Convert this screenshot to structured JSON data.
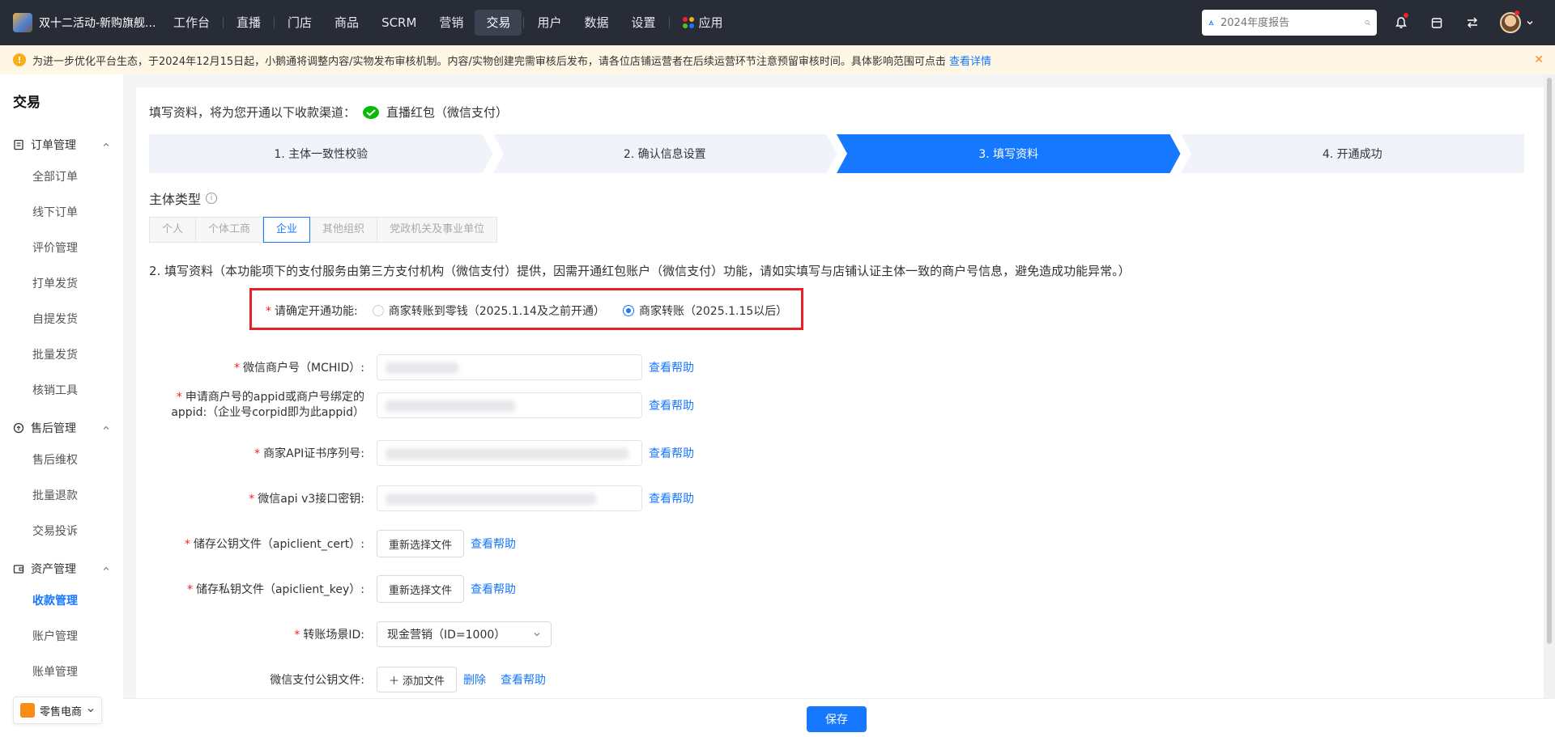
{
  "topbar": {
    "brand": "双十二活动-新购旗舰...",
    "nav": [
      {
        "label": "工作台"
      },
      {
        "label": "直播"
      },
      {
        "label": "门店"
      },
      {
        "label": "商品"
      },
      {
        "label": "SCRM"
      },
      {
        "label": "营销"
      },
      {
        "label": "交易"
      },
      {
        "label": "用户"
      },
      {
        "label": "数据"
      },
      {
        "label": "设置"
      },
      {
        "label": "应用"
      }
    ],
    "search_placeholder": "2024年度报告",
    "accent": "#272c37"
  },
  "notice": {
    "text": "为进一步优化平台生态，于2024年12月15日起，小鹅通将调整内容/实物发布审核机制。内容/实物创建完需审核后发布，请各位店铺运营者在后续运营环节注意预留审核时间。具体影响范围可点击",
    "link": "查看详情"
  },
  "sidebar": {
    "title": "交易",
    "groups": [
      {
        "label": "订单管理",
        "items": [
          "全部订单",
          "线下订单",
          "评价管理",
          "打单发货",
          "自提发货",
          "批量发货",
          "核销工具"
        ]
      },
      {
        "label": "售后管理",
        "items": [
          "售后维权",
          "批量退款",
          "交易投诉"
        ]
      },
      {
        "label": "资产管理",
        "items": [
          "收款管理",
          "账户管理",
          "账单管理"
        ]
      }
    ],
    "shop": "零售电商"
  },
  "main": {
    "channel_prefix": "填写资料，将为您开通以下收款渠道：",
    "channel_name": "直播红包（微信支付）",
    "steps": [
      "1. 主体一致性校验",
      "2. 确认信息设置",
      "3. 填写资料",
      "4. 开通成功"
    ],
    "active_step": 3,
    "subject_title": "主体类型",
    "subject_tabs": [
      "个人",
      "个体工商",
      "企业",
      "其他组织",
      "党政机关及事业单位"
    ],
    "subject_selected": "企业",
    "desc": "2. 填写资料（本功能项下的支付服务由第三方支付机构（微信支付）提供，因需开通红包账户（微信支付）功能，请如实填写与店铺认证主体一致的商户号信息，避免造成功能异常。）",
    "form": {
      "func_label": "请确定开通功能:",
      "func_options": [
        "商家转账到零钱（2025.1.14及之前开通）",
        "商家转账（2025.1.15以后）"
      ],
      "func_selected": "商家转账（2025.1.15以后）",
      "mchid_label": "微信商户号（MCHID）:",
      "appid_label_1": "申请商户号的appid或商户号绑定的",
      "appid_label_2": "appid:（企业号corpid即为此appid）",
      "cert_serial_label": "商家API证书序列号:",
      "apiv3_label": "微信api v3接口密钥:",
      "cert_file_label": "储存公钥文件（apiclient_cert）:",
      "key_file_label": "储存私钥文件（apiclient_key）:",
      "scene_label": "转账场景ID:",
      "scene_value": "现金营销（ID=1000）",
      "pubkey_label": "微信支付公钥文件:",
      "reselect": "重新选择文件",
      "add_file": "添加文件",
      "delete": "删除",
      "help": "查看帮助"
    },
    "save": "保存"
  }
}
